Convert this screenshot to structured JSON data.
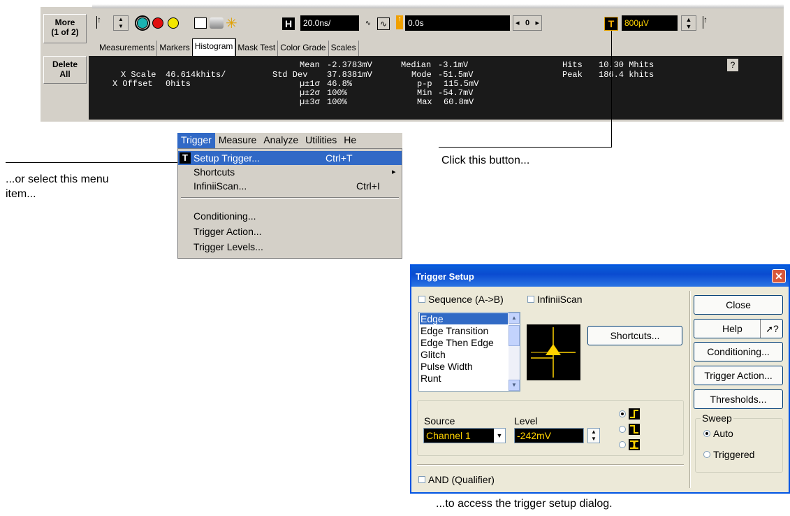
{
  "scope": {
    "side_buttons": [
      {
        "label": "More\n(1 of 2)"
      },
      {
        "label": "Delete\nAll"
      }
    ],
    "timebase": {
      "icon_letter": "H",
      "value": "20.0ns/",
      "delay": "0.0s",
      "nav_value": "0"
    },
    "trigger_level": {
      "icon_letter": "T",
      "value": "800µV"
    },
    "tabs": [
      "Measurements",
      "Markers",
      "Histogram",
      "Mask Test",
      "Color Grade",
      "Scales"
    ],
    "active_tab": "Histogram",
    "help": "?",
    "readout": {
      "x_scale_label": "X Scale",
      "x_scale_value": "46.614khits/",
      "x_offset_label": "X Offset",
      "x_offset_value": "0hits",
      "mean_label": "Mean",
      "mean_value": "-2.3783mV",
      "std_label": "Std Dev",
      "std_value": "37.8381mV",
      "s1_label": "µ±1σ",
      "s1_value": "46.8%",
      "s2_label": "µ±2σ",
      "s2_value": "100%",
      "s3_label": "µ±3σ",
      "s3_value": "100%",
      "median_label": "Median",
      "median_value": "-3.1mV",
      "mode_label": "Mode",
      "mode_value": "-51.5mV",
      "pp_label": "p-p",
      "pp_value": "115.5mV",
      "min_label": "Min",
      "min_value": "-54.7mV",
      "max_label": "Max",
      "max_value": "60.8mV",
      "hits_label": "Hits",
      "hits_value": "10.30 Mhits",
      "peak_label": "Peak",
      "peak_value": "186.4 khits"
    }
  },
  "annotations": {
    "menu_note": "...or select this menu\nitem...",
    "button_note": "Click this button...",
    "dialog_note": "...to access the trigger setup dialog."
  },
  "menubar": [
    "Trigger",
    "Measure",
    "Analyze",
    "Utilities",
    "He"
  ],
  "trigger_menu": {
    "items": [
      {
        "label": "Setup Trigger...",
        "accel": "Ctrl+T",
        "icon": "T"
      },
      {
        "label": "Shortcuts",
        "submenu": "▸"
      },
      {
        "label": "InfiniiScan...",
        "accel": "Ctrl+I"
      },
      {
        "label": "Conditioning..."
      },
      {
        "label": "Trigger Action..."
      },
      {
        "label": "Trigger Levels..."
      }
    ]
  },
  "dialog": {
    "title": "Trigger Setup",
    "close_x": "✕",
    "sequence_label": "Sequence (A->B)",
    "infiniiscan_label": "InfiniiScan",
    "trigger_types": [
      "Edge",
      "Edge Transition",
      "Edge Then Edge",
      "Glitch",
      "Pulse Width",
      "Runt"
    ],
    "selected_type": "Edge",
    "shortcuts_button": "Shortcuts...",
    "source_label": "Source",
    "source_value": "Channel 1",
    "level_label": "Level",
    "level_value": "-242mV",
    "and_label": "AND (Qualifier)",
    "close_button": "Close",
    "help_button": "Help",
    "whats_this": "?",
    "conditioning_button": "Conditioning...",
    "trigger_action_button": "Trigger Action...",
    "thresholds_button": "Thresholds...",
    "sweep_label": "Sweep",
    "sweep_auto": "Auto",
    "sweep_triggered": "Triggered",
    "sweep_selected": "Auto"
  }
}
